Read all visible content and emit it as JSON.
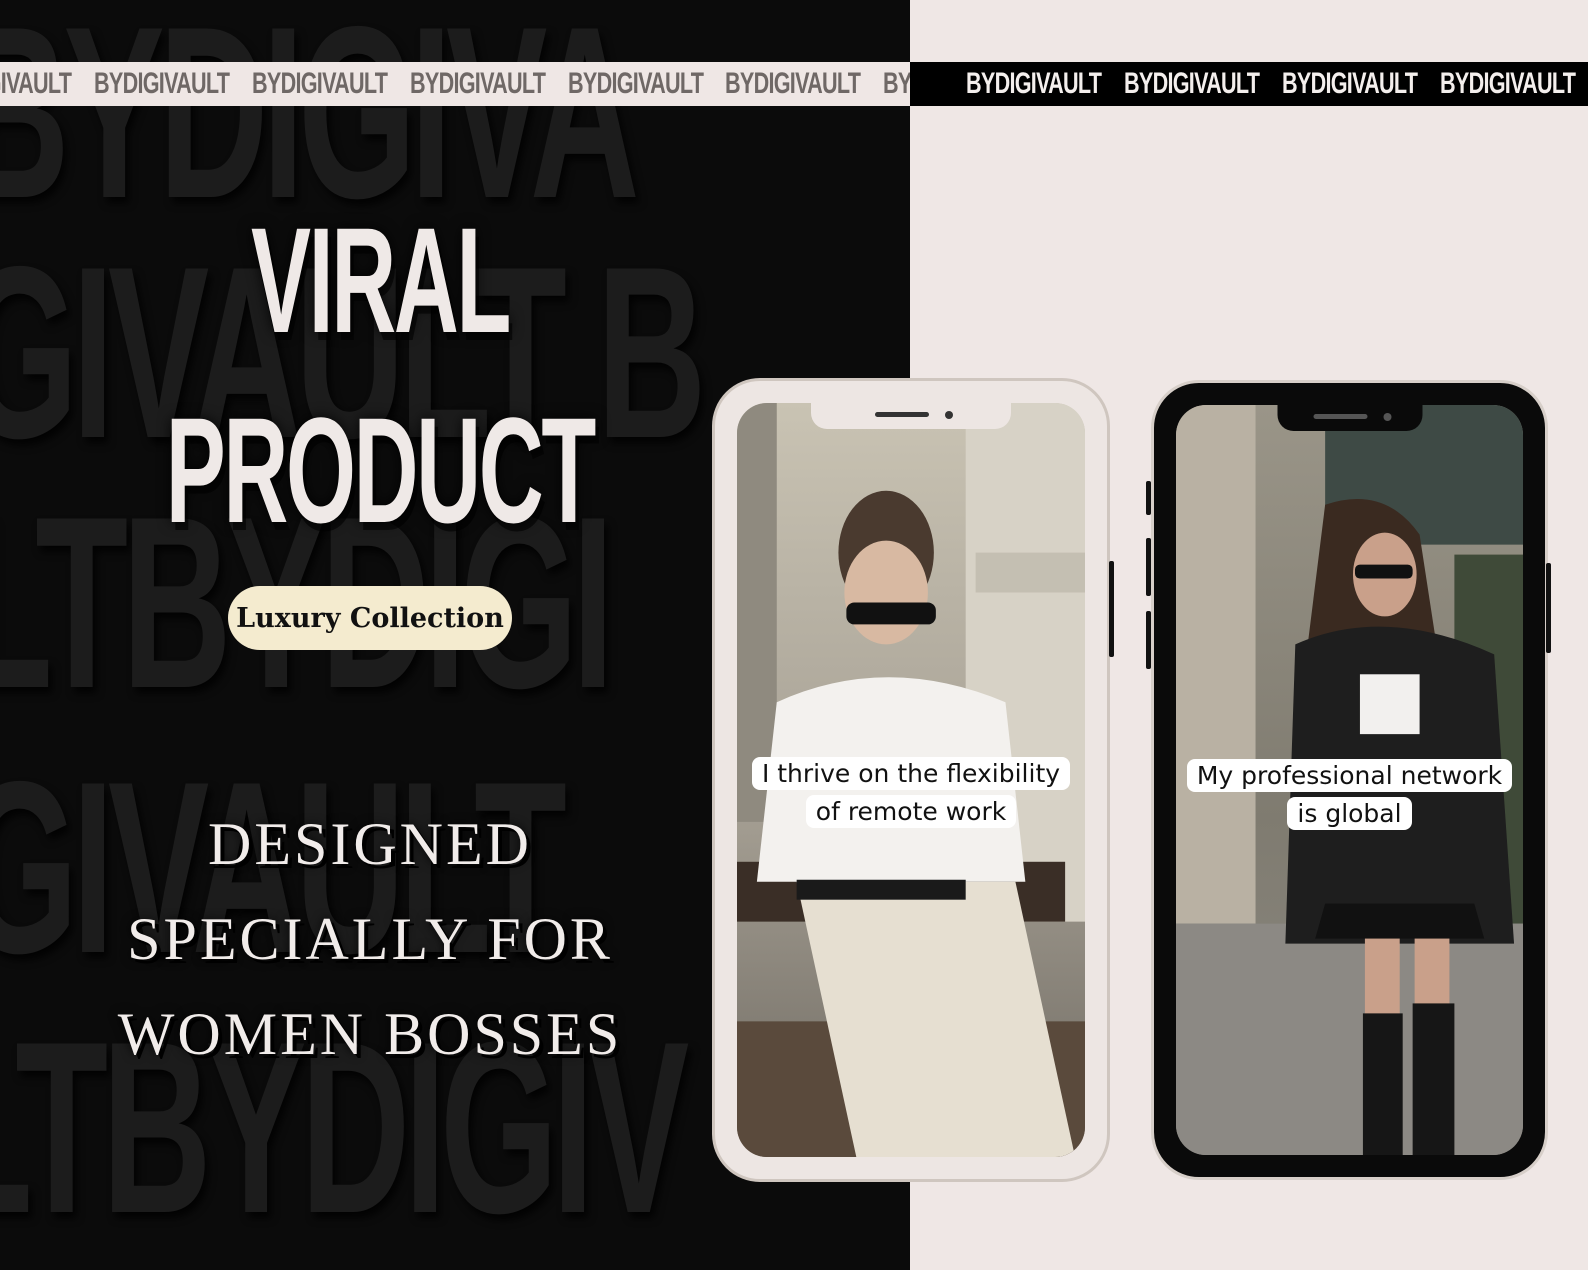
{
  "brand": "BYDIGIVAULT",
  "background_words": [
    "BYDIGIVA",
    "GIVAULT B",
    "LTBYDIGI",
    "LTBYDIGI",
    "GIVAULT",
    "LTBYDIGIV"
  ],
  "headline": {
    "line1": "VIRAL",
    "line2": "PRODUCT"
  },
  "badge": "Luxury Collection",
  "tagline": [
    "DESIGNED",
    "SPECIALLY FOR",
    "WOMEN BOSSES"
  ],
  "phones": [
    {
      "caption_line1": "I thrive on the flexibility",
      "caption_line2": "of remote work",
      "frame": "light"
    },
    {
      "caption_line1": "My professional network",
      "caption_line2": "is global",
      "frame": "dark"
    }
  ],
  "colors": {
    "dark_bg": "#0b0b0b",
    "light_bg": "#efe7e5",
    "badge_bg": "#f4ebcf"
  }
}
